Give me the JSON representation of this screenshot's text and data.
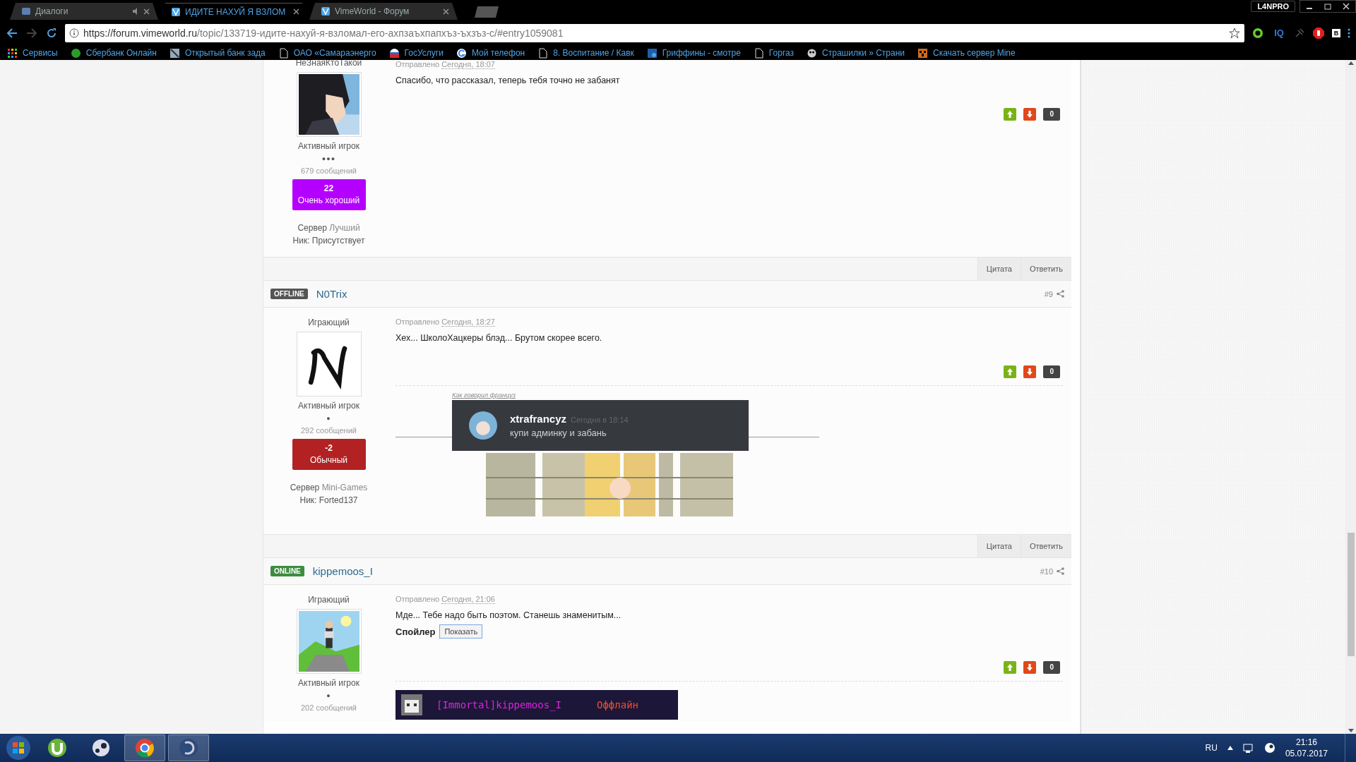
{
  "browser": {
    "tabs": [
      {
        "title": "Диалоги",
        "selected": false,
        "muted_icon": true
      },
      {
        "title": "ИДИТЕ НАХУЙ Я ВЗЛОМ",
        "selected": true,
        "muted_icon": false
      },
      {
        "title": "VimeWorld - Форум",
        "selected": false,
        "muted_icon": false
      }
    ],
    "profile": "L4NPRO",
    "url": {
      "host": "https://forum.vimeworld.ru",
      "path": "/topic/133719-идите-нахуй-я-взломал-его-ахпзаъхпапхъз-ъхзъз-с/#entry1059081"
    },
    "bookmarks": [
      "Сервисы",
      "Сбербанк Онлайн",
      "Открытый банк зада",
      "ОАО «Самараэнерго",
      "ГосУслуги",
      "Мой телефон",
      "8. Воспитание / Кавк",
      "Гриффины - смотре",
      "Горгаз",
      "Страшилки » Страни",
      "Скачать сервер Mine"
    ],
    "extensions": [
      "IQ",
      "B"
    ]
  },
  "posts": [
    {
      "author": {
        "name": "НеЗнаяКтоТакой",
        "title": "Активный игрок",
        "pips": "●●●",
        "messages": "679 сообщений",
        "reputation": {
          "value": "22",
          "label": "Очень хороший",
          "color": "#b400ff"
        },
        "server_label": "Сервер",
        "server": "Лучший",
        "nick": "Ник: Присутствует"
      },
      "posted_label": "Отправлено",
      "posted_time": "Сегодня, 18:07",
      "text": "Спасибо, что рассказал, теперь тебя точно не забанят",
      "votes": "0",
      "footer": [
        "Цитата",
        "Ответить"
      ]
    },
    {
      "header": {
        "status": "OFFLINE",
        "online": false,
        "name": "N0Trix",
        "number": "#9"
      },
      "author": {
        "group": "Играющий",
        "title": "Активный игрок",
        "pips": "●",
        "messages": "292 сообщений",
        "reputation": {
          "value": "-2",
          "label": "Обычный",
          "color": "#b22222"
        },
        "server_label": "Сервер",
        "server": "Mini-Games",
        "nick": "Ник: Forted137"
      },
      "posted_label": "Отправлено",
      "posted_time": "Сегодня, 18:27",
      "text": "Хех... ШколоХацкеры блэд... Брутом скорее всего.",
      "votes": "0",
      "signature": {
        "kind": "quote",
        "caption": "Как говорил француз",
        "user": "xtrafrancyz",
        "time": "Сегодня в 18:14",
        "message": "купи админку и забань"
      },
      "footer": [
        "Цитата",
        "Ответить"
      ]
    },
    {
      "header": {
        "status": "ONLINE",
        "online": true,
        "name": "kippemoos_I",
        "number": "#10"
      },
      "author": {
        "group": "Играющий",
        "title": "Активный игрок",
        "pips": "●",
        "messages": "202 сообщений"
      },
      "posted_label": "Отправлено",
      "posted_time": "Сегодня, 21:06",
      "text": "Мде... Тебе надо быть поэтом. Станешь знаменитым...",
      "spoiler": {
        "label": "Спойлер",
        "button": "Показать"
      },
      "votes": "0",
      "signature": {
        "kind": "banner",
        "player": "[Immortal]kippemoos_I",
        "state": "Оффлайн"
      }
    }
  ],
  "taskbar": {
    "language": "RU",
    "time": "21:16",
    "date": "05.07.2017"
  }
}
